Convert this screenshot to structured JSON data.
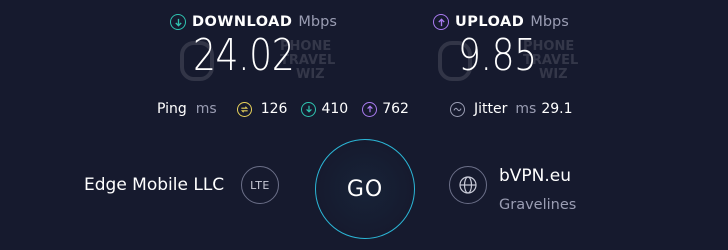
{
  "download": {
    "label": "DOWNLOAD",
    "unit": "Mbps",
    "value": "24.02",
    "icon": "download-arrow-icon",
    "color": "#2fc3b0"
  },
  "upload": {
    "label": "UPLOAD",
    "unit": "Mbps",
    "value": "9.85",
    "icon": "upload-arrow-icon",
    "color": "#a97bf0"
  },
  "watermark": {
    "line1": "PHONE",
    "line2": "TRAVEL",
    "line3": "WIZ"
  },
  "ping": {
    "label": "Ping",
    "unit": "ms",
    "idle": "126",
    "download": "410",
    "upload": "762",
    "idle_color": "#e8d25a",
    "download_color": "#2fc3b0",
    "upload_color": "#a97bf0"
  },
  "jitter": {
    "label": "Jitter",
    "unit": "ms",
    "value": "29.1"
  },
  "provider": {
    "name": "Edge Mobile LLC",
    "network": "LTE"
  },
  "go": {
    "label": "GO",
    "color": "#2bb6d6"
  },
  "server": {
    "name": "bVPN.eu",
    "location": "Gravelines"
  }
}
